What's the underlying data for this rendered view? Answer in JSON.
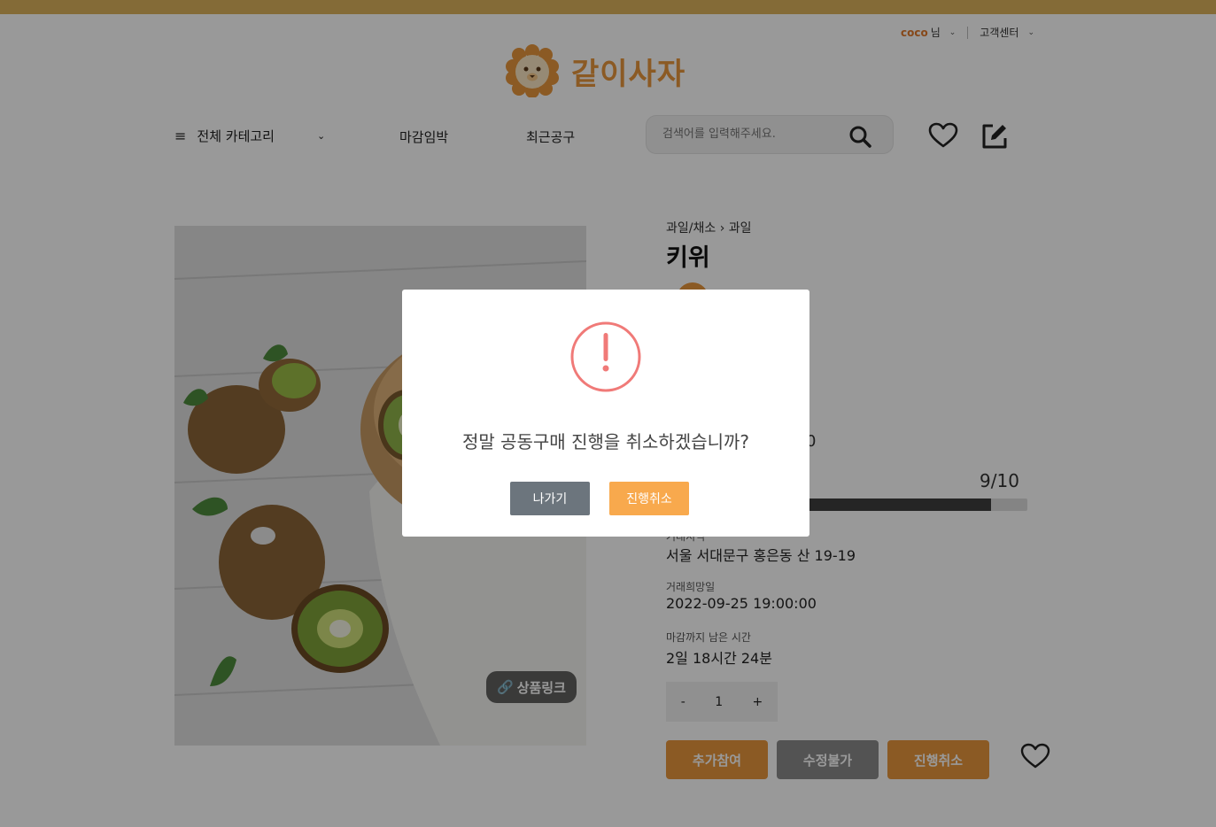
{
  "header": {
    "username": "coco",
    "user_suffix": "님",
    "customer_center": "고객센터",
    "logo_text": "같이사자"
  },
  "nav": {
    "category_label": "전체 카테고리",
    "link_deadline": "마감임박",
    "link_recent": "최근공구",
    "search_placeholder": "검색어를 입력해주세요."
  },
  "product": {
    "breadcrumb_parent": "과일/채소",
    "breadcrumb_child": "과일",
    "title": "키위",
    "link_badge": "상품링크",
    "partial_value_fragment": "0",
    "participants": "9/10",
    "progress_fraction": 0.9,
    "location_label": "거래지역",
    "location": "서울 서대문구 홍은동 산 19-19",
    "date_label": "거래희망일",
    "date": "2022-09-25 19:00:00",
    "remaining_label": "마감까지 남은 시간",
    "remaining": "2일 18시간 24분",
    "quantity": "1",
    "minus": "-",
    "plus": "+",
    "btn_join": "추가참여",
    "btn_edit": "수정불가",
    "btn_cancel": "진행취소"
  },
  "modal": {
    "message": "정말 공동구매 진행을 취소하겠습니까?",
    "btn_exit": "나가기",
    "btn_cancel": "진행취소"
  },
  "colors": {
    "topbar": "#ddb35d",
    "accent_orange": "#e8963c",
    "modal_cancel": "#f8a94d",
    "modal_exit": "#6c757d",
    "warn_red": "#f07a78"
  }
}
